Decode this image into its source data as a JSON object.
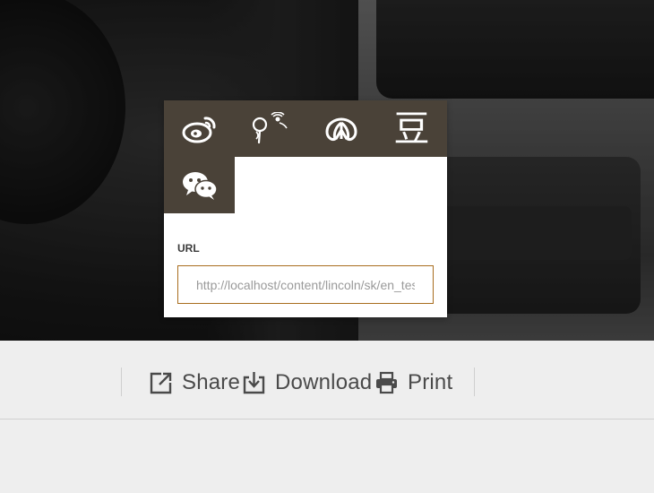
{
  "share_popup": {
    "services": [
      {
        "name": "weibo-icon",
        "label": ""
      },
      {
        "name": "tencent-weibo-icon",
        "label": ""
      },
      {
        "name": "renren-icon",
        "label": ""
      },
      {
        "name": "douban-icon",
        "label": "豆"
      },
      {
        "name": "wechat-icon",
        "label": ""
      }
    ],
    "url_label": "URL",
    "url_value": "http://localhost/content/lincoln/sk/en_tes"
  },
  "toolbar": {
    "share_label": "Share",
    "download_label": "Download",
    "print_label": "Print",
    "icons": {
      "share": "share-external-icon",
      "download": "download-icon",
      "print": "printer-icon"
    }
  },
  "colors": {
    "tile": "#4a4238",
    "input_border": "#a86d1e",
    "toolbar_text": "#4a4a4a"
  }
}
